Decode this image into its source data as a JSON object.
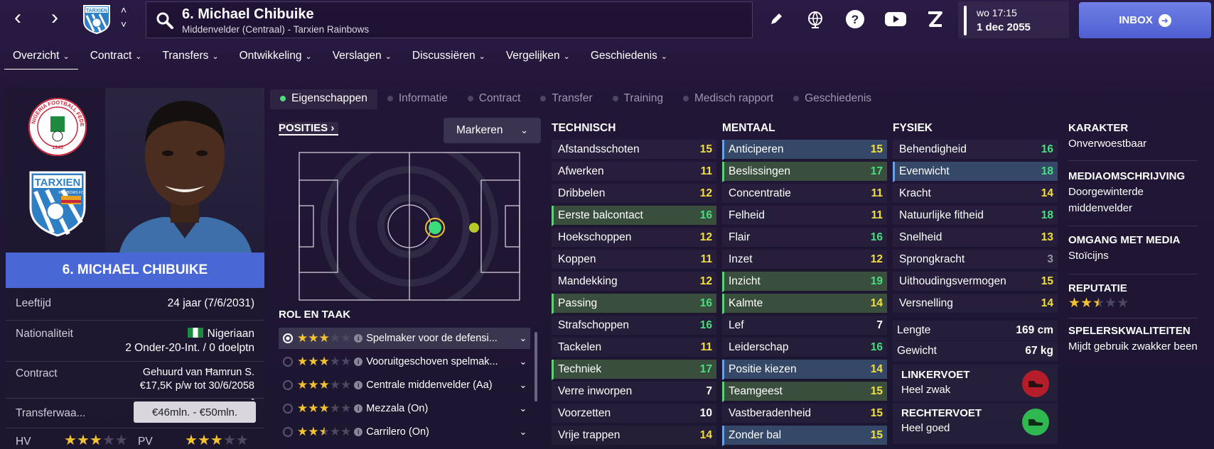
{
  "topbar": {
    "player_title": "6. Michael Chibuike",
    "player_subtitle": "Middenvelder (Centraal) - Tarxien Rainbows",
    "day_time": "wo 17:15",
    "date": "1 dec 2055",
    "inbox_label": "INBOX"
  },
  "menu": [
    {
      "label": "Overzicht"
    },
    {
      "label": "Contract"
    },
    {
      "label": "Transfers"
    },
    {
      "label": "Ontwikkeling"
    },
    {
      "label": "Verslagen"
    },
    {
      "label": "Discussiëren"
    },
    {
      "label": "Vergelijken"
    },
    {
      "label": "Geschiedenis"
    }
  ],
  "tabs": [
    {
      "label": "Eigenschappen"
    },
    {
      "label": "Informatie"
    },
    {
      "label": "Contract"
    },
    {
      "label": "Transfer"
    },
    {
      "label": "Training"
    },
    {
      "label": "Medisch rapport"
    },
    {
      "label": "Geschiedenis"
    }
  ],
  "player": {
    "name_banner": "6. MICHAEL CHIBUIKE",
    "age_label": "Leeftijd",
    "age_value": "24 jaar (7/6/2031)",
    "nat_label": "Nationaliteit",
    "nat_value": "Nigeriaan",
    "nat_caps": "2 Onder-20-Int. / 0 doelptn",
    "contract_label": "Contract",
    "contract_line1": "Gehuurd van Ħamrun S.",
    "contract_line2": "€17,5K p/w tot 30/6/2058",
    "contract_line3": "-",
    "transfer_label": "Transferwaa...",
    "transfer_value": "€46mln. - €50mln.",
    "hv_label": "HV",
    "hv_stars": 3,
    "pv_label": "PV",
    "pv_stars": 3
  },
  "crest_text": {
    "nff_ring": "NIGERIA FOOTBALL FEDERATION",
    "nff_year": "1945",
    "club_name": "TARXIEN",
    "club_sub": "RAINBOWS FC"
  },
  "positions": {
    "button_label": "POSITIES",
    "dropdown_label": "Markeren"
  },
  "roles": {
    "title": "ROL EN TAAK",
    "items": [
      {
        "name": "Spelmaker voor de defensi...",
        "stars": 3
      },
      {
        "name": "Vooruitgeschoven spelmak...",
        "stars": 3
      },
      {
        "name": "Centrale middenvelder (Aa)",
        "stars": 3
      },
      {
        "name": "Mezzala (On)",
        "stars": 3
      },
      {
        "name": "Carrilero (On)",
        "stars": 2.5
      }
    ]
  },
  "technical": {
    "header": "TECHNISCH",
    "items": [
      {
        "name": "Afstandsschoten",
        "value": "15",
        "color": "yellow",
        "hl": ""
      },
      {
        "name": "Afwerken",
        "value": "11",
        "color": "yellow",
        "hl": ""
      },
      {
        "name": "Dribbelen",
        "value": "12",
        "color": "yellow",
        "hl": ""
      },
      {
        "name": "Eerste balcontact",
        "value": "16",
        "color": "green",
        "hl": "green"
      },
      {
        "name": "Hoekschoppen",
        "value": "12",
        "color": "yellow",
        "hl": ""
      },
      {
        "name": "Koppen",
        "value": "11",
        "color": "yellow",
        "hl": ""
      },
      {
        "name": "Mandekking",
        "value": "12",
        "color": "yellow",
        "hl": ""
      },
      {
        "name": "Passing",
        "value": "16",
        "color": "green",
        "hl": "green"
      },
      {
        "name": "Strafschoppen",
        "value": "16",
        "color": "green",
        "hl": ""
      },
      {
        "name": "Tackelen",
        "value": "11",
        "color": "yellow",
        "hl": ""
      },
      {
        "name": "Techniek",
        "value": "17",
        "color": "green",
        "hl": "green"
      },
      {
        "name": "Verre inworpen",
        "value": "7",
        "color": "white",
        "hl": ""
      },
      {
        "name": "Voorzetten",
        "value": "10",
        "color": "white",
        "hl": ""
      },
      {
        "name": "Vrije trappen",
        "value": "14",
        "color": "yellow",
        "hl": ""
      }
    ]
  },
  "mental": {
    "header": "MENTAAL",
    "items": [
      {
        "name": "Anticiperen",
        "value": "15",
        "color": "yellow",
        "hl": "blue"
      },
      {
        "name": "Beslissingen",
        "value": "17",
        "color": "green",
        "hl": "green"
      },
      {
        "name": "Concentratie",
        "value": "11",
        "color": "yellow",
        "hl": ""
      },
      {
        "name": "Felheid",
        "value": "11",
        "color": "yellow",
        "hl": ""
      },
      {
        "name": "Flair",
        "value": "16",
        "color": "green",
        "hl": ""
      },
      {
        "name": "Inzet",
        "value": "12",
        "color": "yellow",
        "hl": ""
      },
      {
        "name": "Inzicht",
        "value": "19",
        "color": "green",
        "hl": "green"
      },
      {
        "name": "Kalmte",
        "value": "14",
        "color": "yellow",
        "hl": "green"
      },
      {
        "name": "Lef",
        "value": "7",
        "color": "white",
        "hl": ""
      },
      {
        "name": "Leiderschap",
        "value": "16",
        "color": "green",
        "hl": ""
      },
      {
        "name": "Positie kiezen",
        "value": "14",
        "color": "yellow",
        "hl": "blue"
      },
      {
        "name": "Teamgeest",
        "value": "15",
        "color": "yellow",
        "hl": "green"
      },
      {
        "name": "Vastberadenheid",
        "value": "15",
        "color": "yellow",
        "hl": ""
      },
      {
        "name": "Zonder bal",
        "value": "15",
        "color": "yellow",
        "hl": "blue"
      }
    ]
  },
  "physical": {
    "header": "FYSIEK",
    "items": [
      {
        "name": "Behendigheid",
        "value": "16",
        "color": "green",
        "hl": ""
      },
      {
        "name": "Evenwicht",
        "value": "18",
        "color": "green",
        "hl": "blue"
      },
      {
        "name": "Kracht",
        "value": "14",
        "color": "yellow",
        "hl": ""
      },
      {
        "name": "Natuurlijke fitheid",
        "value": "18",
        "color": "green",
        "hl": ""
      },
      {
        "name": "Snelheid",
        "value": "13",
        "color": "yellow",
        "hl": ""
      },
      {
        "name": "Sprongkracht",
        "value": "3",
        "color": "grey",
        "hl": ""
      },
      {
        "name": "Uithoudingsvermogen",
        "value": "15",
        "color": "yellow",
        "hl": ""
      },
      {
        "name": "Versnelling",
        "value": "14",
        "color": "yellow",
        "hl": ""
      }
    ],
    "length_label": "Lengte",
    "length_value": "169 cm",
    "weight_label": "Gewicht",
    "weight_value": "67 kg",
    "left_foot_title": "LINKERVOET",
    "left_foot_value": "Heel zwak",
    "right_foot_title": "RECHTERVOET",
    "right_foot_value": "Heel goed"
  },
  "right": {
    "karakter_title": "KARAKTER",
    "karakter_value": "Onverwoestbaar",
    "media_title": "MEDIAOMSCHRIJVING",
    "media_value": "Doorgewinterde middenvelder",
    "omgang_title": "OMGANG MET MEDIA",
    "omgang_value": "Stoïcijns",
    "rep_title": "REPUTATIE",
    "rep_stars": 2.5,
    "kwal_title": "SPELERSKWALITEITEN",
    "kwal_value": "Mijdt gebruik zwakker been"
  },
  "colors": {
    "accent": "#4a67d6",
    "green": "#4ade80",
    "yellow": "#f2e040",
    "inbox": "#5f6fdc"
  },
  "icons": [
    "back-arrow-icon",
    "forward-arrow-icon",
    "search-icon",
    "pencil-icon",
    "globe-icon",
    "help-icon",
    "youtube-icon",
    "z-icon",
    "chevron-down-icon",
    "info-icon",
    "boot-icon"
  ]
}
